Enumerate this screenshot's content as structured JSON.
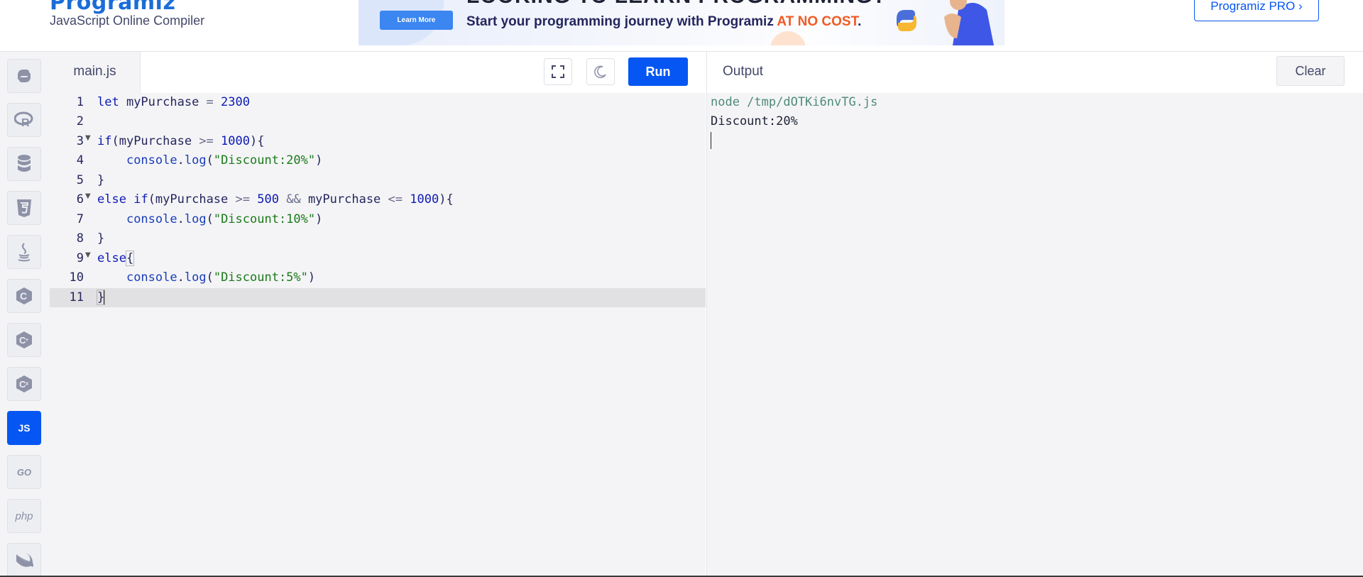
{
  "header": {
    "logo_text": "Programiz",
    "subtitle": "JavaScript Online Compiler",
    "pro_button_label": "Programiz PRO ›"
  },
  "ad": {
    "button_label": "Learn More",
    "headline": "LOOKING TO LEARN PROGRAMMING?",
    "text_prefix": "Start your programming journey with Programiz ",
    "text_highlight": "AT NO COST",
    "text_suffix": "."
  },
  "sidebar": {
    "items": [
      {
        "icon": "python-icon",
        "label": ""
      },
      {
        "icon": "r-icon",
        "label": ""
      },
      {
        "icon": "sql-icon",
        "label": ""
      },
      {
        "icon": "html5-icon",
        "label": ""
      },
      {
        "icon": "java-icon",
        "label": ""
      },
      {
        "icon": "c-icon",
        "label": ""
      },
      {
        "icon": "cplusplus-icon",
        "label": ""
      },
      {
        "icon": "csharp-icon",
        "label": ""
      },
      {
        "icon": "javascript-icon",
        "label": "JS",
        "active": true
      },
      {
        "icon": "go-icon",
        "label": "GO"
      },
      {
        "icon": "php-icon",
        "label": "php"
      },
      {
        "icon": "swift-icon",
        "label": ""
      }
    ]
  },
  "editor": {
    "file_tab": "main.js",
    "run_label": "Run",
    "current_line": 11,
    "lines": [
      {
        "n": "1",
        "text": "let myPurchase = 2300"
      },
      {
        "n": "2",
        "text": ""
      },
      {
        "n": "3",
        "text": "if(myPurchase >= 1000){",
        "fold": true
      },
      {
        "n": "4",
        "text": "    console.log(\"Discount:20%\")"
      },
      {
        "n": "5",
        "text": "}"
      },
      {
        "n": "6",
        "text": "else if(myPurchase >= 500 && myPurchase <= 1000){",
        "fold": true
      },
      {
        "n": "7",
        "text": "    console.log(\"Discount:10%\")"
      },
      {
        "n": "8",
        "text": "}"
      },
      {
        "n": "9",
        "text": "else{",
        "fold": true
      },
      {
        "n": "10",
        "text": "    console.log(\"Discount:5%\")"
      },
      {
        "n": "11",
        "text": "}"
      }
    ]
  },
  "output": {
    "title": "Output",
    "clear_label": "Clear",
    "lines": [
      "node /tmp/dOTKi6nvTG.js",
      "Discount:20%"
    ]
  },
  "colors": {
    "accent": "#0556f3",
    "panel_bg": "#f4f4f6",
    "highlight": "#f15a24"
  }
}
